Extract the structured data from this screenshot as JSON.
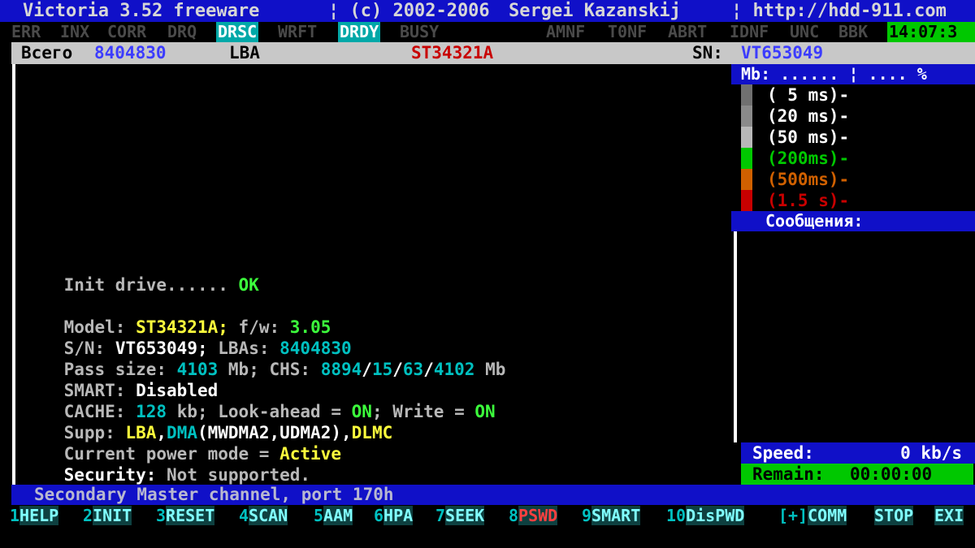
{
  "title_bar": {
    "app": "Victoria 3.52 freeware",
    "copyright": "¦ (c) 2002-2006",
    "author": "Sergei Kazanskij",
    "url": "¦ http://hdd-911.com"
  },
  "flags": [
    {
      "label": "ERR",
      "on": false
    },
    {
      "label": "INX",
      "on": false
    },
    {
      "label": "CORR",
      "on": false
    },
    {
      "label": "DRQ",
      "on": false
    },
    {
      "label": "DRSC",
      "on": true
    },
    {
      "label": "WRFT",
      "on": false
    },
    {
      "label": "DRDY",
      "on": true
    },
    {
      "label": "BUSY",
      "on": false
    },
    {
      "label": "AMNF",
      "on": false
    },
    {
      "label": "T0NF",
      "on": false
    },
    {
      "label": "ABRT",
      "on": false
    },
    {
      "label": "IDNF",
      "on": false
    },
    {
      "label": "UNC",
      "on": false
    },
    {
      "label": "BBK",
      "on": false
    }
  ],
  "clock": "14:07:3",
  "info_bar": {
    "total_label": "Всего",
    "total_value": "8404830",
    "mode": "LBA",
    "model": "ST34321A",
    "sn_label": "SN:",
    "sn_value": "VT653049"
  },
  "log": {
    "init_label": "Init drive......",
    "init_status": "OK",
    "model_label": "Model:",
    "model_value": "ST34321A;",
    "fw_label": "f/w:",
    "fw_value": "3.05",
    "sn_label": "S/N:",
    "sn_value": "VT653049;",
    "lbas_label": "LBAs:",
    "lbas_value": "8404830",
    "pass_label": "Pass size:",
    "pass_value": "4103",
    "pass_unit": "Mb; CHS:",
    "chs_c": "8894",
    "chs_h": "15",
    "chs_s": "63",
    "chs_mb": "4102",
    "chs_unit": "Mb",
    "smart_label": "SMART:",
    "smart_value": "Disabled",
    "cache_label": "CACHE:",
    "cache_value": "128",
    "cache_unit": "kb; Look-ahead =",
    "lookahead": "ON",
    "write_label": "; Write =",
    "write_value": "ON",
    "supp_label": "Supp:",
    "supp_lba": "LBA",
    "supp_dma": "DMA",
    "supp_modes": "(MWDMA2,UDMA2)",
    "supp_dlmc": "DLMC",
    "power_label": "Current power mode =",
    "power_value": "Active",
    "security_label": "Security:",
    "security_value": "Not supported."
  },
  "right_panel": {
    "header": "Mb: ...... ¦ .... %",
    "legend": [
      {
        "label": "( 5 ms)-",
        "color": "#ffffff"
      },
      {
        "label": "(20 ms)-",
        "color": "#ffffff"
      },
      {
        "label": "(50 ms)-",
        "color": "#ffffff"
      },
      {
        "label": "(200ms)-",
        "color": "#00c800"
      },
      {
        "label": "(500ms)-",
        "color": "#d06000"
      },
      {
        "label": "(1.5 s)-",
        "color": "#c80000"
      }
    ],
    "legend_swatches": [
      "#707070",
      "#8a8a8a",
      "#b8b8b8",
      "#00c800",
      "#d06000",
      "#c80000"
    ],
    "messages_header": "Сообщения:",
    "speed_label": "Speed:",
    "speed_value": "0 kb/s",
    "remain_label": "Remain:",
    "remain_value": "00:00:00"
  },
  "status_bar": "Secondary Master channel, port 170h",
  "function_keys": [
    {
      "num": "1",
      "label": "HELP"
    },
    {
      "num": "2",
      "label": "INIT"
    },
    {
      "num": "3",
      "label": "RESET"
    },
    {
      "num": "4",
      "label": "SCAN"
    },
    {
      "num": "5",
      "label": "AAM"
    },
    {
      "num": "6",
      "label": "HPA"
    },
    {
      "num": "7",
      "label": "SEEK"
    },
    {
      "num": "8",
      "label": "PSWD"
    },
    {
      "num": "9",
      "label": "SMART"
    },
    {
      "num": "10",
      "label": "DisPWD"
    },
    {
      "num": "[+]",
      "label": "COMM"
    },
    {
      "num": "",
      "label": "STOP"
    },
    {
      "num": "",
      "label": "EXI"
    }
  ]
}
